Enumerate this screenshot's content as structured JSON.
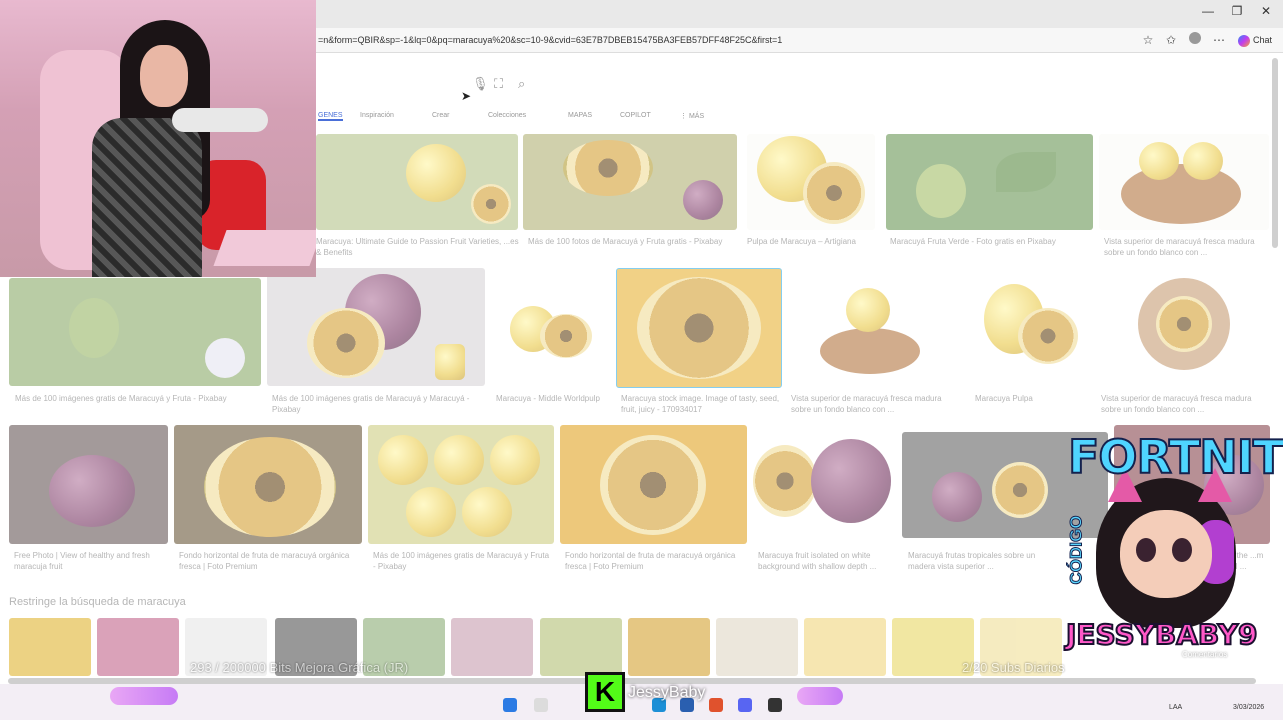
{
  "browser": {
    "url": "=n&form=QBIR&sp=-1&lq=0&pq=maracuya%20&sc=10-9&cvid=63E7B7DBEB15475BA3FEB57DFF48F25C&first=1",
    "chat_label": "Chat",
    "window_controls": [
      "—",
      "❐",
      "✕"
    ]
  },
  "search": {
    "tabs": [
      "GENES",
      "Inspiración",
      "Crear",
      "Colecciones",
      "MAPAS",
      "COPILOT",
      "⋮ MÁS"
    ]
  },
  "results": {
    "row1": [
      "Maracuya: Ultimate Guide to Passion Fruit Varieties, ...es & Benefits",
      "Más de 100 fotos de Maracuyá y Fruta gratis - Pixabay",
      "Pulpa de Maracuya – Artigiana",
      "Maracuyá Fruta Verde - Foto gratis en Pixabay",
      "Vista superior de maracuyá fresca madura sobre un fondo blanco con ..."
    ],
    "row2": [
      "Más de 100 imágenes gratis de Maracuyá y Fruta - Pixabay",
      "Más de 100 imágenes gratis de Maracuyá y Maracuyá - Pixabay",
      "Maracuya - Middle Worldpulp",
      "Maracuya stock image. Image of tasty, seed, fruit, juicy - 170934017",
      "Vista superior de maracuyá fresca madura sobre un fondo blanco con ...",
      "Maracuya Pulpa",
      "Vista superior de maracuyá fresca madura sobre un fondo blanco con ..."
    ],
    "row3": [
      "Free Photo | View of healthy and fresh maracuja fruit",
      "Fondo horizontal de fruta de maracuyá orgánica fresca | Foto Premium",
      "Más de 100 imágenes gratis de Maracuyá y Fruta - Pixabay",
      "Fondo horizontal de fruta de maracuyá orgánica fresca | Foto Premium",
      "Maracuya fruit isolated on white background with shallow depth ...",
      "Maracuyá frutas tropicales sobre un madera vista superior ...",
      "...the ...m AI ..."
    ]
  },
  "refine": {
    "title": "Restringe la búsqueda de maracuya"
  },
  "stream": {
    "bits_goal": "293 / 200000 Bits Mejora Gráfica (JR)",
    "subs_goal": "2/20 Subs Diarios",
    "kick_letter": "K",
    "streamer_name": "JessyBaby",
    "brand_game": "FORTNITE",
    "brand_codigo": "CÓDIGO",
    "brand_name": "JESSYBABY9",
    "comments_label": "Comentarios"
  },
  "taskbar": {
    "lang": "LAA",
    "date": "3/03/2026"
  },
  "colors": {
    "accent": "#4a6fd8",
    "kick_green": "#53fc18",
    "brand_pink": "#ff58c8",
    "brand_blue": "#4fd5ff"
  }
}
